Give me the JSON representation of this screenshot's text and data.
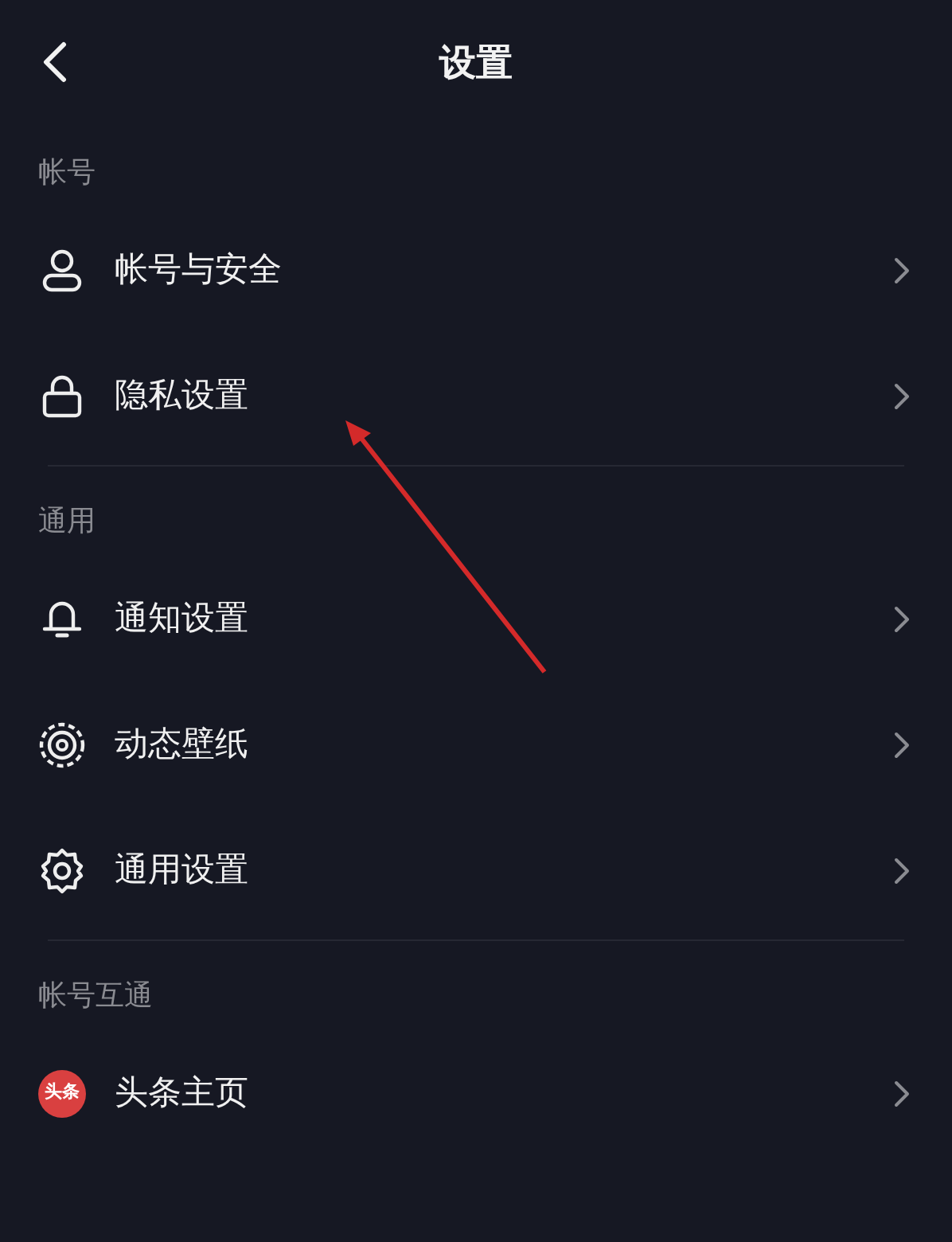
{
  "header": {
    "title": "设置"
  },
  "sections": [
    {
      "label": "帐号",
      "items": [
        {
          "kind": "person",
          "label": "帐号与安全"
        },
        {
          "kind": "lock",
          "label": "隐私设置"
        }
      ]
    },
    {
      "label": "通用",
      "items": [
        {
          "kind": "bell",
          "label": "通知设置"
        },
        {
          "kind": "wallpaper",
          "label": "动态壁纸"
        },
        {
          "kind": "gear",
          "label": "通用设置"
        }
      ]
    },
    {
      "label": "帐号互通",
      "items": [
        {
          "kind": "app",
          "label": "头条主页",
          "icon_text": "头条"
        }
      ]
    }
  ]
}
